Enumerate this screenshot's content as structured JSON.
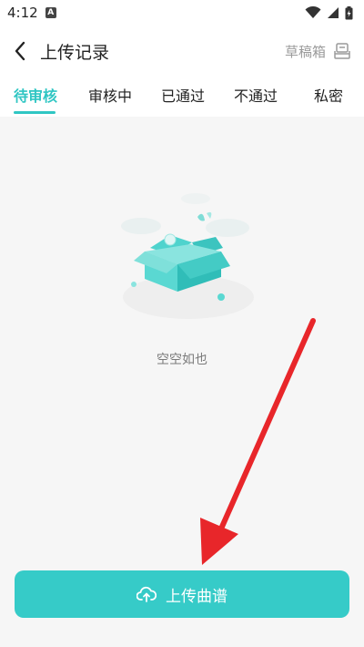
{
  "status_bar": {
    "time": "4:12",
    "notification_glyph": "A",
    "icons": [
      "wifi-icon",
      "signal-icon",
      "battery-icon"
    ]
  },
  "header": {
    "title": "上传记录",
    "drafts_label": "草稿箱"
  },
  "tabs": [
    {
      "label": "待审核",
      "active": true
    },
    {
      "label": "审核中",
      "active": false
    },
    {
      "label": "已通过",
      "active": false
    },
    {
      "label": "不通过",
      "active": false
    },
    {
      "label": "私密",
      "active": false
    }
  ],
  "empty_state": {
    "message": "空空如也"
  },
  "upload_button": {
    "label": "上传曲谱"
  },
  "colors": {
    "accent": "#2fc6c3",
    "button": "#36cbc8",
    "annotation": "#e8262a"
  }
}
